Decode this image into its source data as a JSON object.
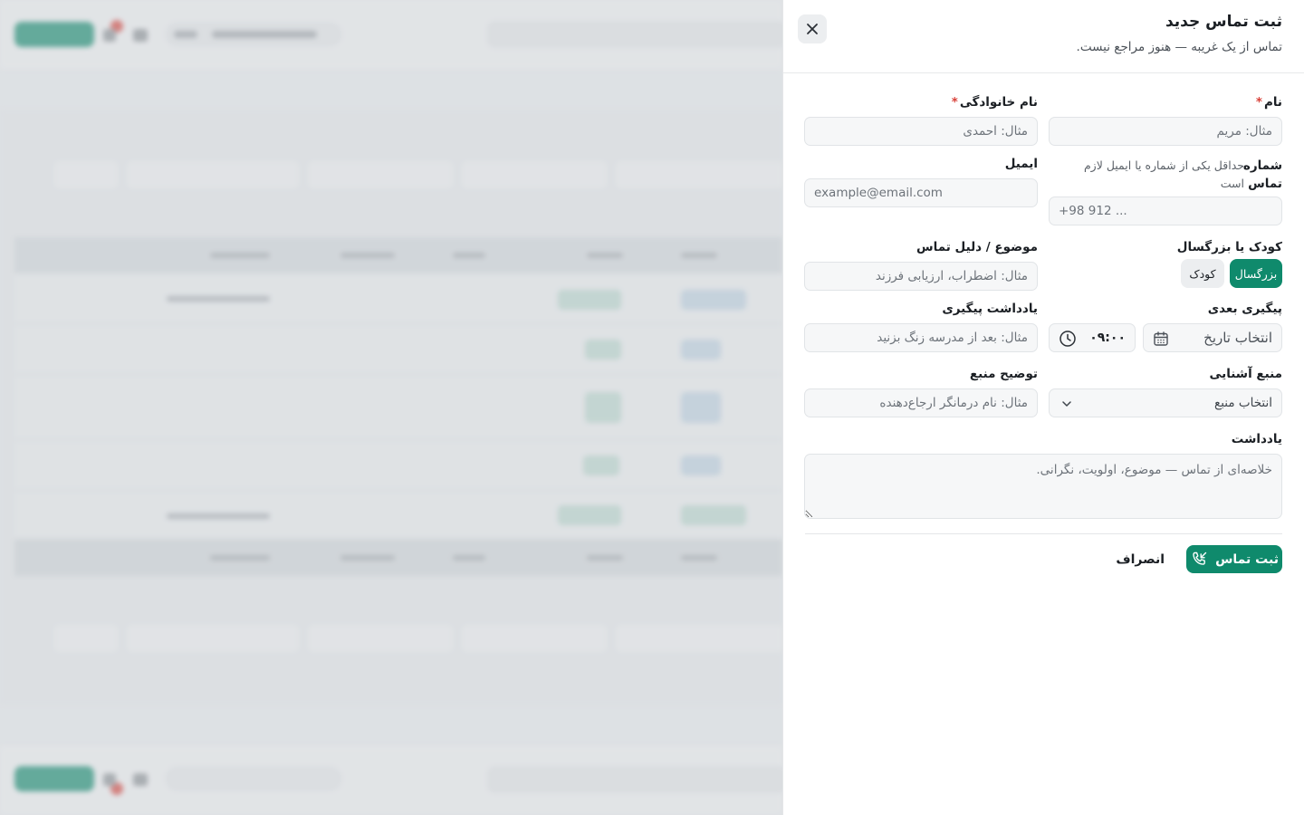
{
  "drawer": {
    "title": "ثبت تماس جدید",
    "subtitle": "تماس از یک غریبه — هنوز مراجع نیست.",
    "close_icon": "close-icon"
  },
  "form": {
    "first_name": {
      "label": "نام",
      "required_mark": "*",
      "placeholder": "مثال: مریم"
    },
    "last_name": {
      "label": "نام خانوادگی",
      "required_mark": "*",
      "placeholder": "مثال: احمدی"
    },
    "phone": {
      "label": "شماره تماس",
      "hint": "حداقل یکی از شماره یا ایمیل لازم است",
      "placeholder": "+98 912 ..."
    },
    "email": {
      "label": "ایمیل",
      "placeholder": "example@email.com"
    },
    "age_group": {
      "label": "کودک یا بزرگسال",
      "options": [
        "بزرگسال",
        "کودک"
      ],
      "selected": "بزرگسال"
    },
    "topic": {
      "label": "موضوع / دلیل تماس",
      "placeholder": "مثال: اضطراب، ارزیابی فرزند"
    },
    "next_followup": {
      "label": "پیگیری بعدی",
      "date_placeholder": "انتخاب تاریخ",
      "time_value": "۰۹:۰۰",
      "calendar_icon": "calendar-icon",
      "clock_icon": "clock-icon"
    },
    "followup_note": {
      "label": "یادداشت پیگیری",
      "placeholder": "مثال: بعد از مدرسه زنگ بزنید"
    },
    "referral_source": {
      "label": "منبع آشنایی",
      "selected": "انتخاب منبع",
      "chevron_icon": "chevron-down-icon"
    },
    "source_detail": {
      "label": "توضیح منبع",
      "placeholder": "مثال: نام درمانگر ارجاع‌دهنده"
    },
    "note": {
      "label": "یادداشت",
      "placeholder": "خلاصه‌ای از تماس — موضوع، اولویت، نگرانی."
    }
  },
  "actions": {
    "submit_label": "ثبت تماس",
    "submit_icon": "phone-incoming-icon",
    "cancel_label": "انصراف"
  },
  "colors": {
    "accent": "#0f8a6c",
    "required": "#d9423a"
  }
}
